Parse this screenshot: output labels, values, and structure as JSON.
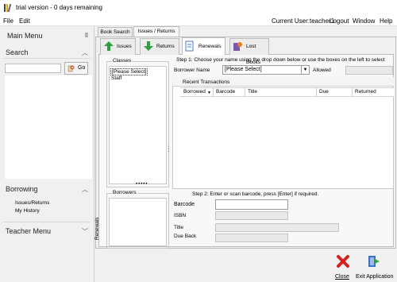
{
  "window": {
    "title": "trial version - 0 days remaining"
  },
  "menu": {
    "file": "File",
    "edit": "Edit",
    "current_user": "Current User:teacher1",
    "logout": "Logout",
    "window": "Window",
    "help": "Help"
  },
  "sidebar": {
    "main_menu": "Main Menu",
    "pin": "ʬ",
    "search_title": "Search",
    "go": "Go",
    "borrowing_title": "Borrowing",
    "borrowing_items": [
      "Issues/Returns",
      "My History"
    ],
    "teacher_title": "Teacher Menu"
  },
  "tabs": [
    "Book Search",
    "Issues / Returns"
  ],
  "subtabs": [
    "Issues",
    "Returns",
    "Renewals",
    "Lost Books"
  ],
  "classes": {
    "title": "Classes",
    "items": [
      "[Please Select]",
      "Staff"
    ]
  },
  "borrowers": {
    "title": "Borrowers"
  },
  "vertical_label": "Renewals",
  "step1": "Step 1: Choose your name using the drop down below or use the boxes on the left to select",
  "borrower_name_label": "Borrower Name",
  "borrower_select_value": "[Please Select]",
  "allowed_label": "Allowed",
  "recent_transactions": "Recent Transactions",
  "columns": [
    "Borrowed",
    "Barcode",
    "Title",
    "Due",
    "Returned"
  ],
  "step2": "Step 2: Enter or scan barcode, press [Enter] if required.",
  "fields": {
    "barcode": "Barcode",
    "isbn": "ISBN",
    "title": "Title",
    "due_back": "Due Back"
  },
  "footer": {
    "close": "Close",
    "exit": "Exit Application"
  }
}
